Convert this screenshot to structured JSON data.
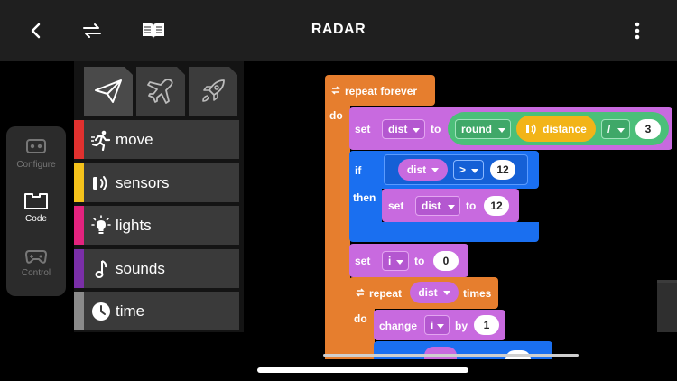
{
  "header": {
    "title": "RADAR",
    "icons": [
      "back-chevron-icon",
      "sync-icon",
      "book-icon",
      "more-vertical-icon"
    ]
  },
  "nav": {
    "items": [
      {
        "label": "Configure",
        "icon": "robot-face-icon",
        "active": false
      },
      {
        "label": "Code",
        "icon": "code-tab-icon",
        "active": true
      },
      {
        "label": "Control",
        "icon": "gamepad-icon",
        "active": false
      }
    ]
  },
  "palette": {
    "levels": [
      {
        "icon": "paper-plane-icon",
        "selected": true
      },
      {
        "icon": "airplane-icon",
        "selected": false
      },
      {
        "icon": "rocket-icon",
        "selected": false
      }
    ],
    "categories": [
      {
        "label": "move",
        "icon": "running-figure-icon",
        "color": "#e0312f"
      },
      {
        "label": "sensors",
        "icon": "distance-sensor-icon",
        "color": "#f4c21b"
      },
      {
        "label": "lights",
        "icon": "lightbulb-icon",
        "color": "#e3237e"
      },
      {
        "label": "sounds",
        "icon": "music-note-icon",
        "color": "#7a2fa8"
      },
      {
        "label": "time",
        "icon": "clock-icon",
        "color": "#8a8a8a"
      }
    ]
  },
  "code": {
    "repeat_forever": "repeat forever",
    "do": "do",
    "set1": {
      "kw": "set",
      "var": "dist",
      "to": "to",
      "round": "round",
      "sensor": "distance",
      "op": "/",
      "value": "3"
    },
    "if_block": {
      "if": "if",
      "var": "dist",
      "op": ">",
      "value": "12",
      "then": "then"
    },
    "set2": {
      "kw": "set",
      "var": "dist",
      "to": "to",
      "value": "12"
    },
    "set3": {
      "kw": "set",
      "var": "i",
      "to": "to",
      "value": "0"
    },
    "repeat": {
      "kw": "repeat",
      "var": "dist",
      "times": "times",
      "do": "do"
    },
    "change": {
      "kw": "change",
      "var": "i",
      "by": "by",
      "value": "1"
    }
  },
  "colors": {
    "control": "#e67e2e",
    "variable": "#c86adf",
    "logic": "#1a6ff0",
    "math": "#4bbf79",
    "sensor": "#f2b418",
    "topbar": "#1f1f1f"
  }
}
